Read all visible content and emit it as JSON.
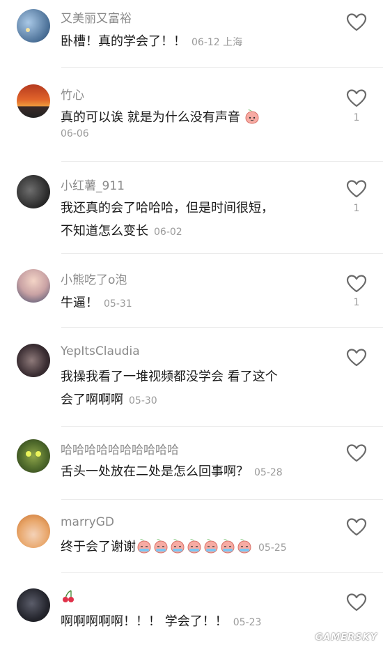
{
  "comments": [
    {
      "username": "又美丽又富裕",
      "text": "卧槽！真的学会了！！",
      "meta": "06-12 上海",
      "likes": ""
    },
    {
      "username": "竹心",
      "text": "真的可以诶 就是为什么没有声音",
      "meta": "06-06",
      "likes": "1",
      "emoji": "peach-face"
    },
    {
      "username": "小红薯_911",
      "text_line1": "我还真的会了哈哈哈，但是时间很短，",
      "text_line2": "不知道怎么变长",
      "meta": "06-02",
      "likes": "1"
    },
    {
      "username": "小熊吃了o泡",
      "text": "牛逼！",
      "meta": "05-31",
      "likes": "1"
    },
    {
      "username": "YepItsClaudia",
      "text_line1": "我操我看了一堆视频都没学会 看了这个",
      "text_line2": "会了啊啊啊",
      "meta": "05-30",
      "likes": ""
    },
    {
      "username": "哈哈哈哈哈哈哈哈哈哈",
      "text": "舌头一处放在二处是怎么回事啊？",
      "meta": "05-28",
      "likes": ""
    },
    {
      "username": "marryGD",
      "text": "终于会了谢谢",
      "meta": "05-25",
      "likes": "",
      "emoji": "peach-crying-x7"
    },
    {
      "username": "",
      "username_emoji": "cherry",
      "text": "啊啊啊啊啊！！！ 学会了！！",
      "meta": "05-23",
      "likes": ""
    }
  ],
  "watermark": "GAMERSKY",
  "colors": {
    "accent_peach": "#f6a7a0",
    "text": "#1a1a1a",
    "muted": "#8a8a8a"
  }
}
